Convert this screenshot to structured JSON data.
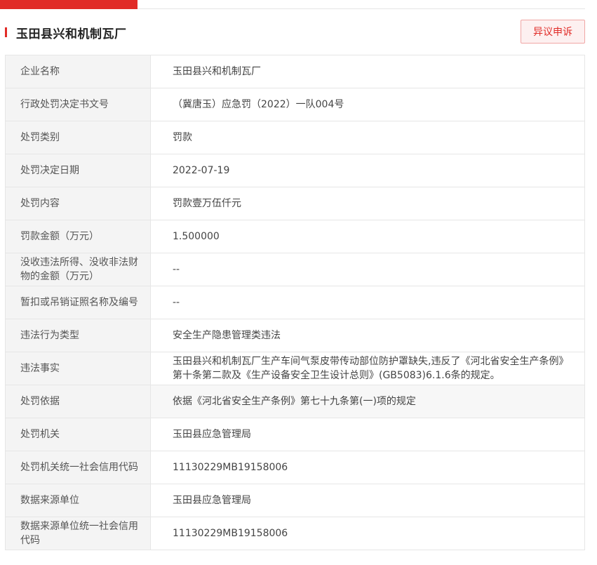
{
  "company_title": "玉田县兴和机制瓦厂",
  "objection_button_label": "异议申诉",
  "rows": [
    {
      "label": "企业名称",
      "value": "玉田县兴和机制瓦厂"
    },
    {
      "label": "行政处罚决定书文号",
      "value": "（冀唐玉）应急罚（2022）一队004号"
    },
    {
      "label": "处罚类别",
      "value": "罚款"
    },
    {
      "label": "处罚决定日期",
      "value": "2022-07-19"
    },
    {
      "label": "处罚内容",
      "value": "罚款壹万伍仟元"
    },
    {
      "label": "罚款金额（万元）",
      "value": "1.500000"
    },
    {
      "label": "没收违法所得、没收非法财物的金额（万元）",
      "value": "--"
    },
    {
      "label": "暂扣或吊销证照名称及编号",
      "value": "--"
    },
    {
      "label": "违法行为类型",
      "value": "安全生产隐患管理类违法"
    },
    {
      "label": "违法事实",
      "value": "玉田县兴和机制瓦厂生产车间气泵皮带传动部位防护罩缺失,违反了《河北省安全生产条例》第十条第二款及《生产设备安全卫生设计总则》(GB5083)6.1.6条的规定。"
    },
    {
      "label": "处罚依据",
      "value": "依据《河北省安全生产条例》第七十九条第(一)项的规定"
    },
    {
      "label": "处罚机关",
      "value": "玉田县应急管理局"
    },
    {
      "label": "处罚机关统一社会信用代码",
      "value": "11130229MB19158006"
    },
    {
      "label": "数据来源单位",
      "value": "玉田县应急管理局"
    },
    {
      "label": "数据来源单位统一社会信用代码",
      "value": "11130229MB19158006"
    }
  ]
}
